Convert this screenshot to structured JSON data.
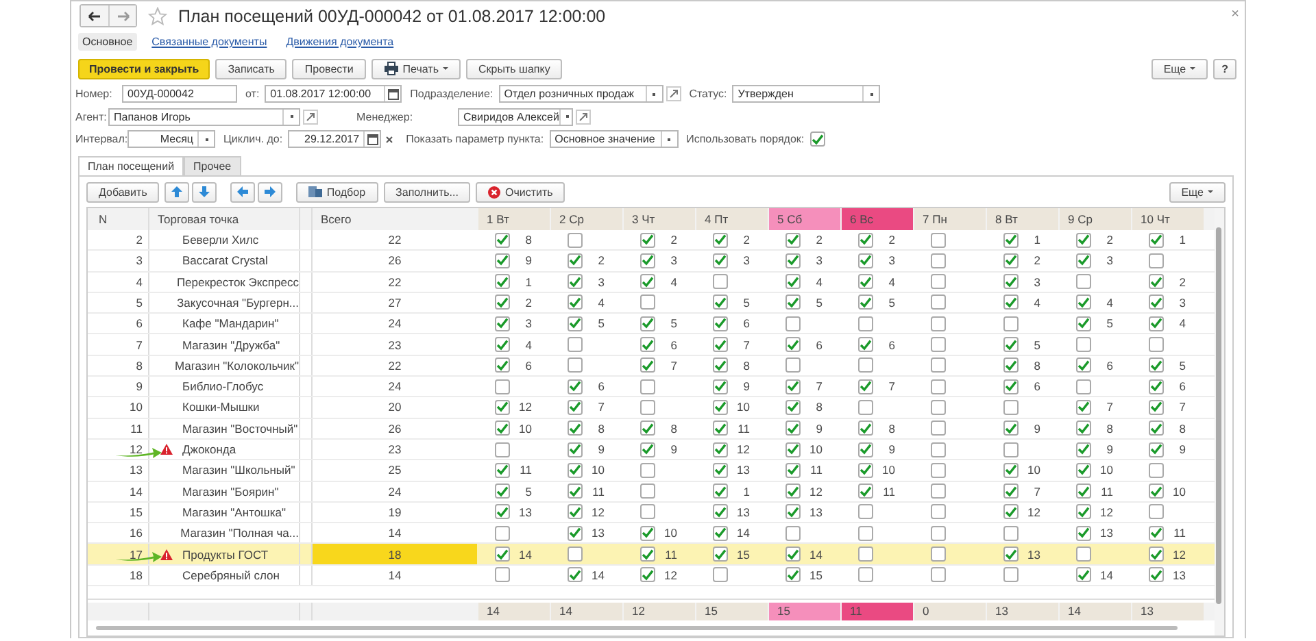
{
  "window": {
    "title": "План посещений 00УД-000042 от 01.08.2017 12:00:00",
    "close": "×"
  },
  "sections": [
    {
      "label": "Основное",
      "selected": true
    },
    {
      "label": "Связанные документы",
      "selected": false
    },
    {
      "label": "Движения документа",
      "selected": false
    }
  ],
  "toolbar": {
    "buttons": [
      {
        "label": "Провести и закрыть",
        "kind": "primary"
      },
      {
        "label": "Записать",
        "kind": "plain"
      },
      {
        "label": "Провести",
        "kind": "plain"
      },
      {
        "label": "Печать",
        "kind": "print"
      },
      {
        "label": "Скрыть шапку",
        "kind": "plain"
      }
    ],
    "more": "Еще",
    "help": "?"
  },
  "header": {
    "number_label": "Номер:",
    "number": "00УД-000042",
    "date_label": "от:",
    "date": "01.08.2017 12:00:00",
    "division_label": "Подразделение:",
    "division": "Отдел розничных продаж",
    "status_label": "Статус:",
    "status": "Утвержден",
    "agent_label": "Агент:",
    "agent": "Папанов Игорь",
    "manager_label": "Менеджер:",
    "manager": "Свиридов Алексей",
    "interval_label": "Интервал:",
    "interval": "Месяц",
    "cycle_label": "Циклич. до:",
    "cycle": "29.12.2017",
    "show_param_label": "Показать параметр пункта:",
    "show_param": "Основное значение",
    "use_order_label": "Использовать порядок:",
    "use_order": true
  },
  "tabs": [
    {
      "label": "План посещений",
      "selected": true
    },
    {
      "label": "Прочее",
      "selected": false
    }
  ],
  "table_toolbar": {
    "add": "Добавить",
    "pick": "Подбор",
    "fill": "Заполнить...",
    "clear": "Очистить",
    "more": "Еще"
  },
  "table": {
    "columns": [
      "N",
      "Торговая точка",
      "Всего"
    ],
    "days": [
      {
        "label": "1 Вт",
        "kind": "weekday",
        "total": "14"
      },
      {
        "label": "2 Ср",
        "kind": "weekday",
        "total": "14"
      },
      {
        "label": "3 Чт",
        "kind": "weekday",
        "total": "12"
      },
      {
        "label": "4 Пт",
        "kind": "weekday",
        "total": "15"
      },
      {
        "label": "5 Сб",
        "kind": "saturday",
        "total": "15"
      },
      {
        "label": "6 Вс",
        "kind": "sunday",
        "total": "11"
      },
      {
        "label": "7 Пн",
        "kind": "weekday",
        "total": "0"
      },
      {
        "label": "8 Вт",
        "kind": "weekday",
        "total": "13"
      },
      {
        "label": "9 Ср",
        "kind": "weekday",
        "total": "14"
      },
      {
        "label": "10 Чт",
        "kind": "weekday",
        "total": "13"
      }
    ],
    "rows": [
      {
        "n": "2",
        "name": "Беверли Хилс",
        "total": "22",
        "warning": false,
        "pointer": false,
        "selected": false,
        "days": [
          {
            "checked": true,
            "value": "8"
          },
          {
            "checked": false
          },
          {
            "checked": true,
            "value": "2"
          },
          {
            "checked": true,
            "value": "2"
          },
          {
            "checked": true,
            "value": "2"
          },
          {
            "checked": true,
            "value": "2"
          },
          {
            "checked": false
          },
          {
            "checked": true,
            "value": "1"
          },
          {
            "checked": true,
            "value": "2"
          },
          {
            "checked": true,
            "value": "1"
          }
        ]
      },
      {
        "n": "3",
        "name": "Baccarat Crystal",
        "total": "26",
        "warning": false,
        "pointer": false,
        "selected": false,
        "days": [
          {
            "checked": true,
            "value": "9"
          },
          {
            "checked": true,
            "value": "2"
          },
          {
            "checked": true,
            "value": "3"
          },
          {
            "checked": true,
            "value": "3"
          },
          {
            "checked": true,
            "value": "3"
          },
          {
            "checked": true,
            "value": "3"
          },
          {
            "checked": false
          },
          {
            "checked": true,
            "value": "2"
          },
          {
            "checked": true,
            "value": "3"
          },
          {
            "checked": false
          }
        ]
      },
      {
        "n": "4",
        "name": "Перекресток Экспресс",
        "total": "22",
        "warning": false,
        "pointer": false,
        "selected": false,
        "days": [
          {
            "checked": true,
            "value": "1"
          },
          {
            "checked": true,
            "value": "3"
          },
          {
            "checked": true,
            "value": "4"
          },
          {
            "checked": false
          },
          {
            "checked": true,
            "value": "4"
          },
          {
            "checked": true,
            "value": "4"
          },
          {
            "checked": false
          },
          {
            "checked": true,
            "value": "3"
          },
          {
            "checked": false
          },
          {
            "checked": true,
            "value": "2"
          }
        ]
      },
      {
        "n": "5",
        "name": "Закусочная \"Бургерн...",
        "total": "27",
        "warning": false,
        "pointer": false,
        "selected": false,
        "days": [
          {
            "checked": true,
            "value": "2"
          },
          {
            "checked": true,
            "value": "4"
          },
          {
            "checked": false
          },
          {
            "checked": true,
            "value": "5"
          },
          {
            "checked": true,
            "value": "5"
          },
          {
            "checked": true,
            "value": "5"
          },
          {
            "checked": false
          },
          {
            "checked": true,
            "value": "4"
          },
          {
            "checked": true,
            "value": "4"
          },
          {
            "checked": true,
            "value": "3"
          }
        ]
      },
      {
        "n": "6",
        "name": "Кафе \"Мандарин\"",
        "total": "24",
        "warning": false,
        "pointer": false,
        "selected": false,
        "days": [
          {
            "checked": true,
            "value": "3"
          },
          {
            "checked": true,
            "value": "5"
          },
          {
            "checked": true,
            "value": "5"
          },
          {
            "checked": true,
            "value": "6"
          },
          {
            "checked": false
          },
          {
            "checked": false
          },
          {
            "checked": false
          },
          {
            "checked": false
          },
          {
            "checked": true,
            "value": "5"
          },
          {
            "checked": true,
            "value": "4"
          }
        ]
      },
      {
        "n": "7",
        "name": "Магазин \"Дружба\"",
        "total": "23",
        "warning": false,
        "pointer": false,
        "selected": false,
        "days": [
          {
            "checked": true,
            "value": "4"
          },
          {
            "checked": false
          },
          {
            "checked": true,
            "value": "6"
          },
          {
            "checked": true,
            "value": "7"
          },
          {
            "checked": true,
            "value": "6"
          },
          {
            "checked": true,
            "value": "6"
          },
          {
            "checked": false
          },
          {
            "checked": true,
            "value": "5"
          },
          {
            "checked": false
          },
          {
            "checked": false
          }
        ]
      },
      {
        "n": "8",
        "name": "Магазин \"Колокольчик\"",
        "total": "22",
        "warning": false,
        "pointer": false,
        "selected": false,
        "days": [
          {
            "checked": true,
            "value": "6"
          },
          {
            "checked": false
          },
          {
            "checked": true,
            "value": "7"
          },
          {
            "checked": true,
            "value": "8"
          },
          {
            "checked": false
          },
          {
            "checked": false
          },
          {
            "checked": false
          },
          {
            "checked": true,
            "value": "8"
          },
          {
            "checked": true,
            "value": "6"
          },
          {
            "checked": true,
            "value": "5"
          }
        ]
      },
      {
        "n": "9",
        "name": "Библио-Глобус",
        "total": "24",
        "warning": false,
        "pointer": false,
        "selected": false,
        "days": [
          {
            "checked": false
          },
          {
            "checked": true,
            "value": "6"
          },
          {
            "checked": false
          },
          {
            "checked": true,
            "value": "9"
          },
          {
            "checked": true,
            "value": "7"
          },
          {
            "checked": true,
            "value": "7"
          },
          {
            "checked": false
          },
          {
            "checked": true,
            "value": "6"
          },
          {
            "checked": false
          },
          {
            "checked": true,
            "value": "6"
          }
        ]
      },
      {
        "n": "10",
        "name": "Кошки-Мышки",
        "total": "20",
        "warning": false,
        "pointer": false,
        "selected": false,
        "days": [
          {
            "checked": true,
            "value": "12"
          },
          {
            "checked": true,
            "value": "7"
          },
          {
            "checked": false
          },
          {
            "checked": true,
            "value": "10"
          },
          {
            "checked": true,
            "value": "8"
          },
          {
            "checked": false
          },
          {
            "checked": false
          },
          {
            "checked": false
          },
          {
            "checked": true,
            "value": "7"
          },
          {
            "checked": true,
            "value": "7"
          }
        ]
      },
      {
        "n": "11",
        "name": "Магазин \"Восточный\"",
        "total": "26",
        "warning": false,
        "pointer": false,
        "selected": false,
        "days": [
          {
            "checked": true,
            "value": "10"
          },
          {
            "checked": true,
            "value": "8"
          },
          {
            "checked": true,
            "value": "8"
          },
          {
            "checked": true,
            "value": "11"
          },
          {
            "checked": true,
            "value": "9"
          },
          {
            "checked": true,
            "value": "8"
          },
          {
            "checked": false
          },
          {
            "checked": true,
            "value": "9"
          },
          {
            "checked": true,
            "value": "8"
          },
          {
            "checked": true,
            "value": "8"
          }
        ]
      },
      {
        "n": "12",
        "name": "Джоконда",
        "total": "23",
        "warning": true,
        "pointer": true,
        "selected": false,
        "days": [
          {
            "checked": false
          },
          {
            "checked": true,
            "value": "9"
          },
          {
            "checked": true,
            "value": "9"
          },
          {
            "checked": true,
            "value": "12"
          },
          {
            "checked": true,
            "value": "10"
          },
          {
            "checked": true,
            "value": "9"
          },
          {
            "checked": false
          },
          {
            "checked": false
          },
          {
            "checked": true,
            "value": "9"
          },
          {
            "checked": true,
            "value": "9"
          }
        ]
      },
      {
        "n": "13",
        "name": "Магазин \"Школьный\"",
        "total": "25",
        "warning": false,
        "pointer": false,
        "selected": false,
        "days": [
          {
            "checked": true,
            "value": "11"
          },
          {
            "checked": true,
            "value": "10"
          },
          {
            "checked": false
          },
          {
            "checked": true,
            "value": "13"
          },
          {
            "checked": true,
            "value": "11"
          },
          {
            "checked": true,
            "value": "10"
          },
          {
            "checked": false
          },
          {
            "checked": true,
            "value": "10"
          },
          {
            "checked": true,
            "value": "10"
          },
          {
            "checked": false
          }
        ]
      },
      {
        "n": "14",
        "name": "Магазин \"Боярин\"",
        "total": "24",
        "warning": false,
        "pointer": false,
        "selected": false,
        "days": [
          {
            "checked": true,
            "value": "5"
          },
          {
            "checked": true,
            "value": "11"
          },
          {
            "checked": false
          },
          {
            "checked": true,
            "value": "1"
          },
          {
            "checked": true,
            "value": "12"
          },
          {
            "checked": true,
            "value": "11"
          },
          {
            "checked": false
          },
          {
            "checked": true,
            "value": "7"
          },
          {
            "checked": true,
            "value": "11"
          },
          {
            "checked": true,
            "value": "10"
          }
        ]
      },
      {
        "n": "15",
        "name": "Магазин \"Антошка\"",
        "total": "19",
        "warning": false,
        "pointer": false,
        "selected": false,
        "days": [
          {
            "checked": true,
            "value": "13"
          },
          {
            "checked": true,
            "value": "12"
          },
          {
            "checked": false
          },
          {
            "checked": true,
            "value": "13"
          },
          {
            "checked": true,
            "value": "13"
          },
          {
            "checked": false
          },
          {
            "checked": false
          },
          {
            "checked": true,
            "value": "12"
          },
          {
            "checked": true,
            "value": "12"
          },
          {
            "checked": false
          }
        ]
      },
      {
        "n": "16",
        "name": "Магазин \"Полная ча...",
        "total": "14",
        "warning": false,
        "pointer": false,
        "selected": false,
        "days": [
          {
            "checked": false
          },
          {
            "checked": true,
            "value": "13"
          },
          {
            "checked": true,
            "value": "10"
          },
          {
            "checked": true,
            "value": "14"
          },
          {
            "checked": false
          },
          {
            "checked": false
          },
          {
            "checked": false
          },
          {
            "checked": false
          },
          {
            "checked": true,
            "value": "13"
          },
          {
            "checked": true,
            "value": "11"
          }
        ]
      },
      {
        "n": "17",
        "name": "Продукты ГОСТ",
        "total": "18",
        "warning": true,
        "pointer": true,
        "selected": true,
        "days": [
          {
            "checked": true,
            "value": "14"
          },
          {
            "checked": false
          },
          {
            "checked": true,
            "value": "11"
          },
          {
            "checked": true,
            "value": "15"
          },
          {
            "checked": true,
            "value": "14"
          },
          {
            "checked": false
          },
          {
            "checked": false
          },
          {
            "checked": true,
            "value": "13"
          },
          {
            "checked": false
          },
          {
            "checked": true,
            "value": "12"
          }
        ]
      },
      {
        "n": "18",
        "name": "Серебряный слон",
        "total": "14",
        "warning": false,
        "pointer": false,
        "selected": false,
        "days": [
          {
            "checked": false
          },
          {
            "checked": true,
            "value": "14"
          },
          {
            "checked": true,
            "value": "12"
          },
          {
            "checked": false
          },
          {
            "checked": true,
            "value": "15"
          },
          {
            "checked": false
          },
          {
            "checked": false
          },
          {
            "checked": false
          },
          {
            "checked": true,
            "value": "14"
          },
          {
            "checked": true,
            "value": "13"
          }
        ]
      }
    ]
  }
}
